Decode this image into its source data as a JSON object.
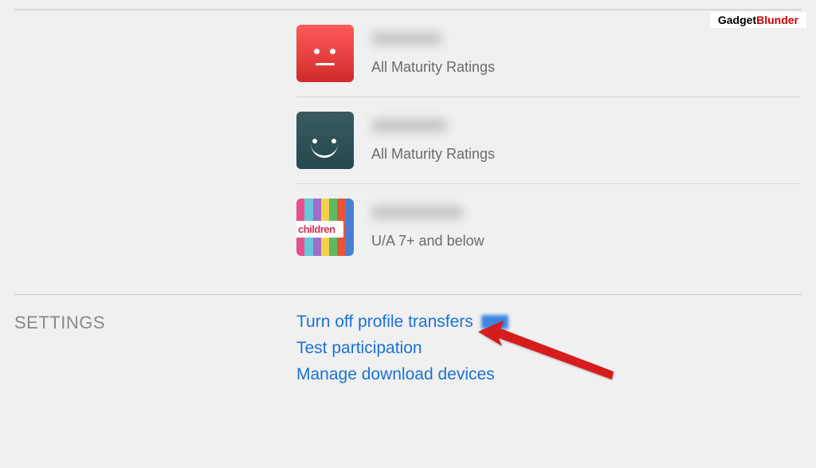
{
  "watermark": {
    "part1": "Gadget",
    "part2": "Blunder"
  },
  "profiles": [
    {
      "name_redacted": true,
      "avatar": "red",
      "rating": "All Maturity Ratings"
    },
    {
      "name_redacted": true,
      "avatar": "teal",
      "rating": "All Maturity Ratings"
    },
    {
      "name_redacted": true,
      "avatar": "children",
      "rating": "U/A 7+ and below"
    }
  ],
  "children_label": "children",
  "settings": {
    "section_label": "SETTINGS",
    "links": {
      "profile_transfers": "Turn off profile transfers",
      "test_participation": "Test participation",
      "manage_downloads": "Manage download devices"
    }
  }
}
